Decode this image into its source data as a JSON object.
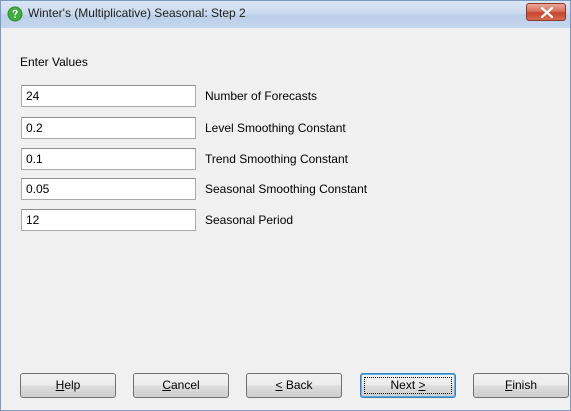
{
  "window": {
    "title": "Winter's (Multiplicative) Seasonal: Step 2",
    "title_icon": "question-icon",
    "close_icon": "close-icon"
  },
  "form": {
    "section_label": "Enter Values",
    "fields": [
      {
        "value": "24",
        "label": "Number of Forecasts"
      },
      {
        "value": "0.2",
        "label": "Level Smoothing Constant"
      },
      {
        "value": "0.1",
        "label": "Trend Smoothing Constant"
      },
      {
        "value": "0.05",
        "label": "Seasonal Smoothing Constant"
      },
      {
        "value": "12",
        "label": "Seasonal Period"
      }
    ]
  },
  "buttons": {
    "help": {
      "mnemonic": "H",
      "rest": "elp"
    },
    "cancel": {
      "mnemonic": "C",
      "rest": "ancel"
    },
    "back": {
      "prefix": "",
      "mnemonic": "<",
      "rest": " Back"
    },
    "next": {
      "prefix": "Next ",
      "mnemonic": ">",
      "rest": ""
    },
    "finish": {
      "mnemonic": "F",
      "rest": "inish"
    }
  },
  "colors": {
    "dialog_background": "#f0f0f0",
    "titlebar": "#c4d6ee",
    "close_button": "#c7452d",
    "default_button_border": "#3c7fb1"
  }
}
